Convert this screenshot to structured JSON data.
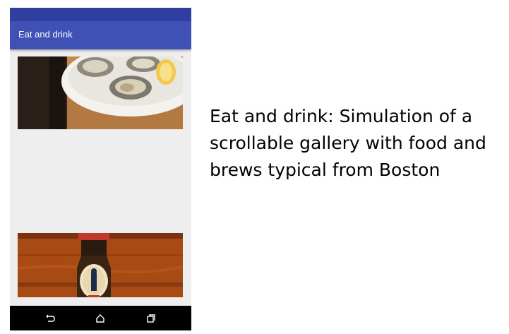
{
  "app": {
    "title": "Eat and drink"
  },
  "gallery": {
    "images": [
      {
        "subject": "oysters-on-ice-with-lemon"
      },
      {
        "subject": "harpoon-beer-bottle"
      }
    ]
  },
  "navbar": {
    "back_icon": "back-icon",
    "home_icon": "home-icon",
    "recents_icon": "recents-icon"
  },
  "caption": {
    "text": "Eat and drink: Simulation of a scrollable gallery with food and brews typical from Boston"
  },
  "colors": {
    "status_bar": "#303f9f",
    "app_bar": "#3f51b5",
    "background": "#eeeeee",
    "nav_bar": "#000000"
  }
}
